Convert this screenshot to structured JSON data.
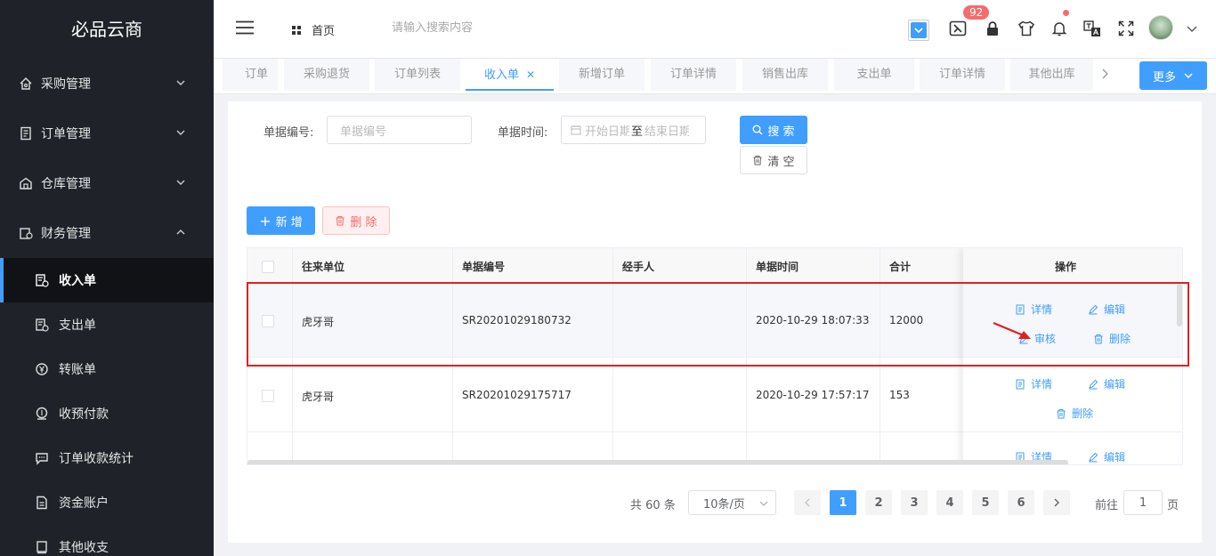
{
  "app": {
    "title": "必品云商"
  },
  "sidebar": {
    "groups": [
      {
        "label": "采购管理",
        "expanded": false
      },
      {
        "label": "订单管理",
        "expanded": false
      },
      {
        "label": "仓库管理",
        "expanded": false
      },
      {
        "label": "财务管理",
        "expanded": true
      }
    ],
    "items": [
      {
        "label": "收入单",
        "active": true
      },
      {
        "label": "支出单"
      },
      {
        "label": "转账单"
      },
      {
        "label": "收预付款"
      },
      {
        "label": "订单收款统计"
      },
      {
        "label": "资金账户"
      },
      {
        "label": "其他收支"
      }
    ]
  },
  "header": {
    "home": "首页",
    "search_placeholder": "请输入搜索内容",
    "badge_count": "92"
  },
  "tabs": {
    "items": [
      {
        "label": "订单"
      },
      {
        "label": "采购退货"
      },
      {
        "label": "订单列表"
      },
      {
        "label": "收入单",
        "active": true
      },
      {
        "label": "新增订单"
      },
      {
        "label": "订单详情"
      },
      {
        "label": "销售出库"
      },
      {
        "label": "支出单"
      },
      {
        "label": "订单详情"
      },
      {
        "label": "其他出库"
      }
    ],
    "more": "更多"
  },
  "filters": {
    "code_label": "单据编号:",
    "code_placeholder": "单据编号",
    "time_label": "单据时间:",
    "start_placeholder": "开始日期",
    "sep": "至",
    "end_placeholder": "结束日期",
    "search": "搜 索",
    "clear": "清 空"
  },
  "actions": {
    "add": "新 增",
    "delete": "删 除"
  },
  "table": {
    "columns": [
      "往来单位",
      "单据编号",
      "经手人",
      "单据时间",
      "合计",
      "操作"
    ],
    "rows": [
      {
        "unit": "虎牙哥",
        "code": "SR20201029180732",
        "handler": "",
        "time": "2020-10-29 18:07:33",
        "total": "12000",
        "ops": [
          "详情",
          "编辑",
          "审核",
          "删除"
        ]
      },
      {
        "unit": "虎牙哥",
        "code": "SR20201029175717",
        "handler": "",
        "time": "2020-10-29 17:57:17",
        "total": "153",
        "ops": [
          "详情",
          "编辑",
          "删除"
        ]
      },
      {
        "unit": "",
        "code": "",
        "handler": "",
        "time": "",
        "total": "",
        "ops": [
          "详情",
          "编辑"
        ]
      }
    ]
  },
  "pagination": {
    "total": "共 60 条",
    "page_size": "10条/页",
    "pages": [
      "1",
      "2",
      "3",
      "4",
      "5",
      "6"
    ],
    "current": "1",
    "goto_label": "前往",
    "goto_value": "1",
    "page_suffix": "页"
  },
  "colors": {
    "primary": "#409eff",
    "sidebar_bg": "#1f2329",
    "danger": "#f56c6c",
    "annotation": "#e02020"
  }
}
